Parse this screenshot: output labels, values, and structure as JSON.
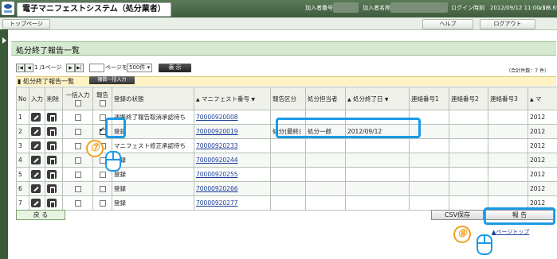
{
  "header": {
    "app_title": "電子マニフェストシステム（処分業者）",
    "subscriber_no_label": "加入者番号",
    "subscriber_name_label": "加入者名称",
    "login_time": "ログイン時刻　2012/09/12 11:00:38",
    "version": "v1.3.65"
  },
  "menu": {
    "top_page": "トップページ",
    "help": "ヘルプ",
    "logout": "ログアウト"
  },
  "page_title": "処分終了報告一覧",
  "pager": {
    "page_indicator": "1 /1ページ",
    "page_go_label": "ページを",
    "per_page": "500件",
    "display_button": "表 示",
    "total_count": "（合計件数：7 件）"
  },
  "section": {
    "title": "処分終了報告一覧",
    "bulk_input_button": "複数一括入力"
  },
  "table": {
    "headers": {
      "no": "No",
      "input": "入力",
      "delete": "削除",
      "bulk_input": "一括入力",
      "report": "報告",
      "status": "登録の状態",
      "manifest_no": "マニフェスト番号",
      "disposal_category": "報告区分",
      "person_in_charge": "処分担当者",
      "disposal_end_date": "処分終了日",
      "contact1": "連絡番号1",
      "contact2": "連絡番号2",
      "contact3": "連絡番号3",
      "extra": "マ"
    },
    "rows": [
      {
        "no": "1",
        "status": "運搬終了報告取消承認待ち",
        "manifest": "70000920008",
        "category": "",
        "person": "",
        "date": "",
        "extra": "2012",
        "report_checked": false
      },
      {
        "no": "2",
        "status": "登録",
        "manifest": "70000920019",
        "category": "処分(最終)",
        "person": "処分一郎",
        "date": "2012/09/12",
        "extra": "2012",
        "report_checked": true
      },
      {
        "no": "3",
        "status": "マニフェスト修正承認待ち",
        "manifest": "70000920233",
        "category": "",
        "person": "",
        "date": "",
        "extra": "2012",
        "report_checked": false
      },
      {
        "no": "4",
        "status": "登録",
        "manifest": "70000920244",
        "category": "",
        "person": "",
        "date": "",
        "extra": "2012",
        "report_checked": false
      },
      {
        "no": "5",
        "status": "登録",
        "manifest": "70000920255",
        "category": "",
        "person": "",
        "date": "",
        "extra": "2012",
        "report_checked": false
      },
      {
        "no": "6",
        "status": "登録",
        "manifest": "70000920266",
        "category": "",
        "person": "",
        "date": "",
        "extra": "2012",
        "report_checked": false
      },
      {
        "no": "7",
        "status": "登録",
        "manifest": "70000920277",
        "category": "",
        "person": "",
        "date": "",
        "extra": "2012",
        "report_checked": false
      }
    ]
  },
  "footer": {
    "back_button": "戻 る",
    "csv_button": "CSV保存",
    "report_button": "報 告",
    "page_top_link": "ページトップ"
  },
  "annotations": {
    "step7": "⑦",
    "step8": "⑧"
  }
}
